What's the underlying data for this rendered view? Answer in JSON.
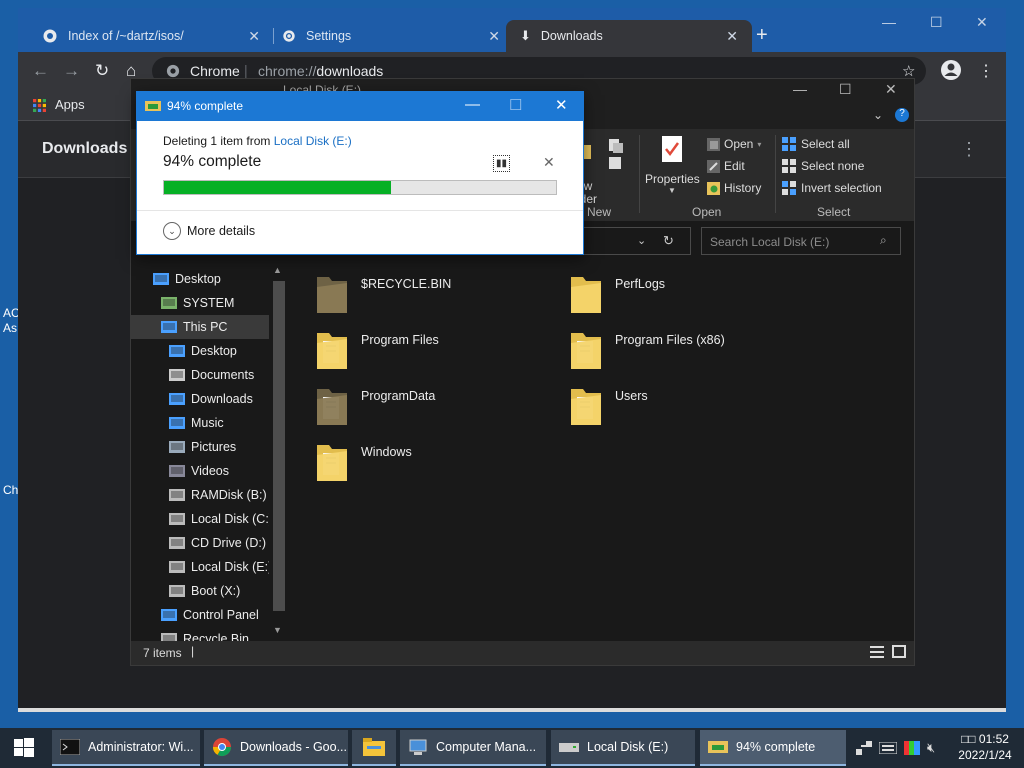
{
  "desktop": {
    "fragments": [
      "AC",
      "As",
      "Ch"
    ]
  },
  "chrome": {
    "tabs": [
      {
        "title": "Index of /~dartz/isos/",
        "icon": "page-icon"
      },
      {
        "title": "Settings",
        "icon": "gear-icon"
      },
      {
        "title": "Downloads",
        "icon": "download-icon",
        "active": true
      }
    ],
    "omnibox": {
      "site": "Chrome",
      "url_prefix": "chrome://",
      "url_host": "downloads"
    },
    "bookmarks": {
      "apps_label": "Apps"
    },
    "page_title": "Downloads"
  },
  "explorer": {
    "title": "Local Disk (E:)",
    "ribbon": {
      "new_label_partial": "ew",
      "new_label_partial2": "lder",
      "properties": "Properties",
      "open": "Open",
      "edit": "Edit",
      "history": "History",
      "select_all": "Select all",
      "select_none": "Select none",
      "invert_selection": "Invert selection",
      "groups": {
        "new": "New",
        "open": "Open",
        "select": "Select"
      }
    },
    "search_placeholder": "Search Local Disk (E:)",
    "nav_items": [
      {
        "label": "Desktop",
        "icon": "desktop-icon",
        "indent": 0
      },
      {
        "label": "SYSTEM",
        "icon": "user-icon",
        "indent": 1
      },
      {
        "label": "This PC",
        "icon": "pc-icon",
        "indent": 1,
        "selected": true
      },
      {
        "label": "Desktop",
        "icon": "desktop-icon",
        "indent": 2
      },
      {
        "label": "Documents",
        "icon": "documents-icon",
        "indent": 2
      },
      {
        "label": "Downloads",
        "icon": "download-arrow-icon",
        "indent": 2
      },
      {
        "label": "Music",
        "icon": "music-icon",
        "indent": 2
      },
      {
        "label": "Pictures",
        "icon": "pictures-icon",
        "indent": 2
      },
      {
        "label": "Videos",
        "icon": "videos-icon",
        "indent": 2
      },
      {
        "label": "RAMDisk (B:)",
        "icon": "drive-icon",
        "indent": 2
      },
      {
        "label": "Local Disk (C:)",
        "icon": "drive-icon",
        "indent": 2
      },
      {
        "label": "CD Drive (D:)",
        "icon": "cd-drive-icon",
        "indent": 2
      },
      {
        "label": "Local Disk (E:)",
        "icon": "drive-icon",
        "indent": 2
      },
      {
        "label": "Boot (X:)",
        "icon": "drive-icon",
        "indent": 2
      },
      {
        "label": "Control Panel",
        "icon": "control-panel-icon",
        "indent": 1
      },
      {
        "label": "Recycle Bin",
        "icon": "recycle-bin-icon",
        "indent": 1
      }
    ],
    "folders": [
      {
        "name": "$RECYCLE.BIN",
        "style": "dark"
      },
      {
        "name": "PerfLogs",
        "style": "plain"
      },
      {
        "name": "Program Files",
        "style": "docs"
      },
      {
        "name": "Program Files (x86)",
        "style": "docs"
      },
      {
        "name": "ProgramData",
        "style": "dark-docs"
      },
      {
        "name": "Users",
        "style": "docs"
      },
      {
        "name": "Windows",
        "style": "docs"
      }
    ],
    "status": {
      "item_count": "7 items"
    }
  },
  "progress_dialog": {
    "title": "94% complete",
    "deleting_prefix": "Deleting 1 item from",
    "deleting_location": "Local Disk (E:)",
    "percent_text": "94% complete",
    "bar_fraction": 0.58,
    "more_details": "More details"
  },
  "taskbar": {
    "buttons": [
      {
        "label": "Administrator: Wi...",
        "icon": "terminal-icon"
      },
      {
        "label": "Downloads - Goo...",
        "icon": "chrome-icon"
      },
      {
        "label": "",
        "icon": "file-explorer-icon"
      },
      {
        "label": "Computer Mana...",
        "icon": "computer-management-icon"
      },
      {
        "label": "Local Disk (E:)",
        "icon": "drive-icon"
      },
      {
        "label": "94% complete",
        "icon": "delete-progress-icon",
        "active": true
      }
    ],
    "clock": {
      "time": "01:52",
      "date": "2022/1/24",
      "time_prefix": "□□"
    }
  },
  "colors": {
    "accent": "#1c78d4",
    "progress_green": "#06b025",
    "explorer_bg": "#191919",
    "chrome_tabstrip": "#1e5ca8"
  }
}
